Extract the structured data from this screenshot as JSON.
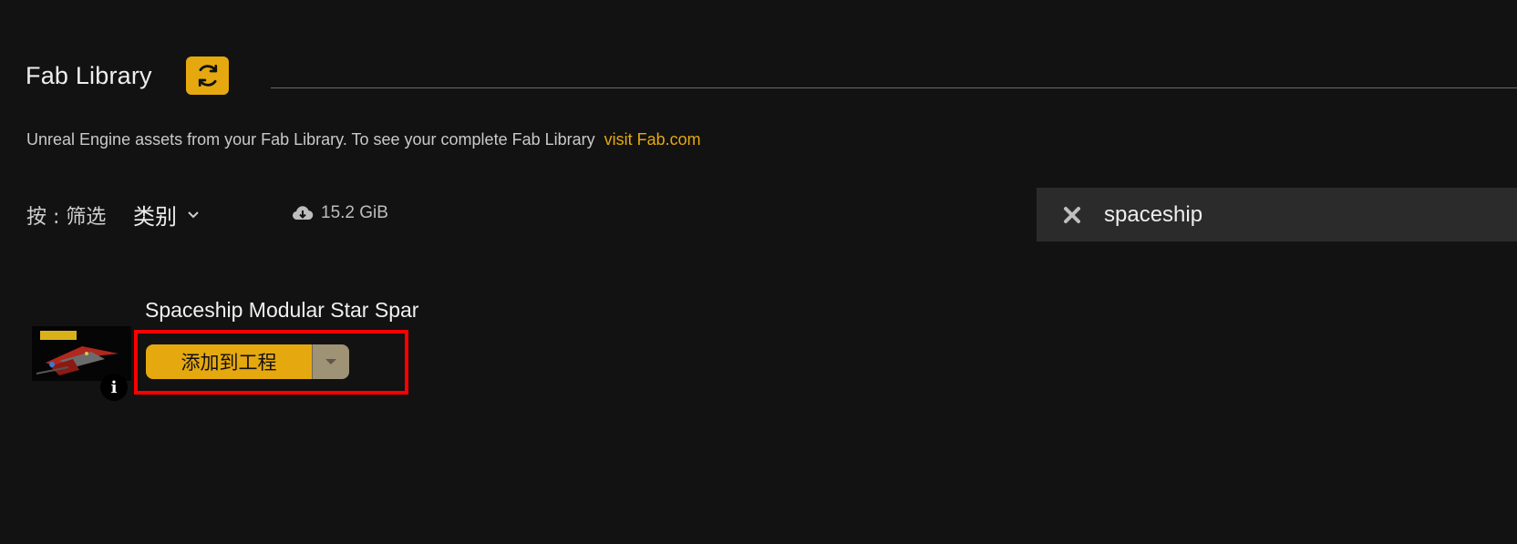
{
  "header": {
    "title": "Fab Library"
  },
  "description": {
    "text": "Unreal Engine assets from your Fab Library. To see your complete Fab Library",
    "link_text": "visit Fab.com"
  },
  "filters": {
    "by_label": "按 : 筛选",
    "category_label": "类别",
    "storage_size": "15.2 GiB"
  },
  "search": {
    "value": "spaceship"
  },
  "asset": {
    "title": "Spaceship Modular Star Spar",
    "add_button_label": "添加到工程"
  },
  "icons": {
    "refresh": "refresh-icon",
    "dropdown": "chevron-down-icon",
    "cloud": "cloud-download-icon",
    "clear": "close-icon",
    "info": "info-icon"
  },
  "colors": {
    "accent": "#e5a80f",
    "background": "#121212",
    "highlight": "#ff0000"
  }
}
